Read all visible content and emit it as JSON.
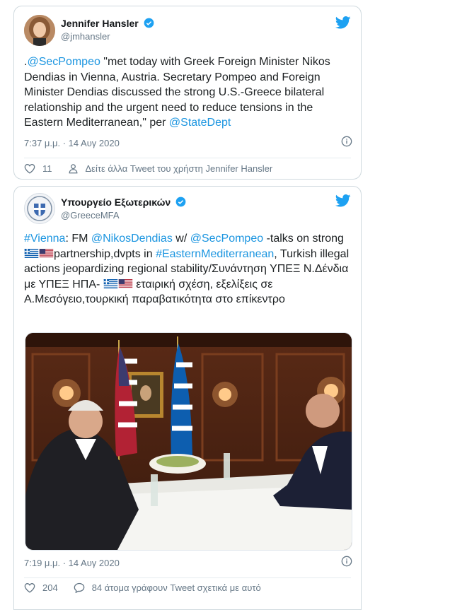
{
  "tweet1": {
    "name": "Jennifer Hansler",
    "handle": "@jmhansler",
    "text_parts": [
      {
        "t": ".",
        "link": false
      },
      {
        "t": "@SecPompeo",
        "link": true
      },
      {
        "t": " \"met today with Greek Foreign Minister Nikos Dendias in Vienna, Austria.  Secretary Pompeo and Foreign Minister Dendias discussed the strong U.S.-Greece bilateral relationship and the urgent need to reduce tensions in the Eastern Mediterranean,\" per ",
        "link": false
      },
      {
        "t": "@StateDept",
        "link": true
      }
    ],
    "time": "7:37 μ.μ. · 14 Αυγ 2020",
    "likes": "11",
    "profile_link": "Δείτε άλλα Tweet του χρήστη Jennifer Hansler"
  },
  "tweet2": {
    "name": "Υπουργείο Εξωτερικών",
    "handle": "@GreeceMFA",
    "text_parts": [
      {
        "t": "#Vienna",
        "link": true
      },
      {
        "t": ": FM ",
        "link": false
      },
      {
        "t": "@NikosDendias",
        "link": true
      },
      {
        "t": " w/ ",
        "link": false
      },
      {
        "t": "@SecPompeo",
        "link": true
      },
      {
        "t": " -talks on strong ",
        "link": false
      },
      {
        "flag": "gr"
      },
      {
        "flag": "us"
      },
      {
        "t": "partnership,dvpts in ",
        "link": false
      },
      {
        "t": "#EasternMediterranean",
        "link": true
      },
      {
        "t": ", Turkish illegal actions jeopardizing regional stability/Συνάντηση ΥΠΕΞ Ν.Δένδια με ΥΠΕΞ ΗΠΑ- ",
        "link": false
      },
      {
        "flag": "gr"
      },
      {
        "flag": "us"
      },
      {
        "t": " εταιρική σχέση, εξελίξεις σε Α.Μεσόγειο,τουρκική παραβατικότητα στο επίκεντρο",
        "link": false
      }
    ],
    "time": "7:19 μ.μ. · 14 Αυγ 2020",
    "likes": "204",
    "conversation": "84 άτομα γράφουν Tweet σχετικά με αυτό"
  },
  "colors": {
    "link": "#1b95e0",
    "verified": "#1da1f2",
    "bird": "#1da1f2",
    "muted": "#657786"
  }
}
